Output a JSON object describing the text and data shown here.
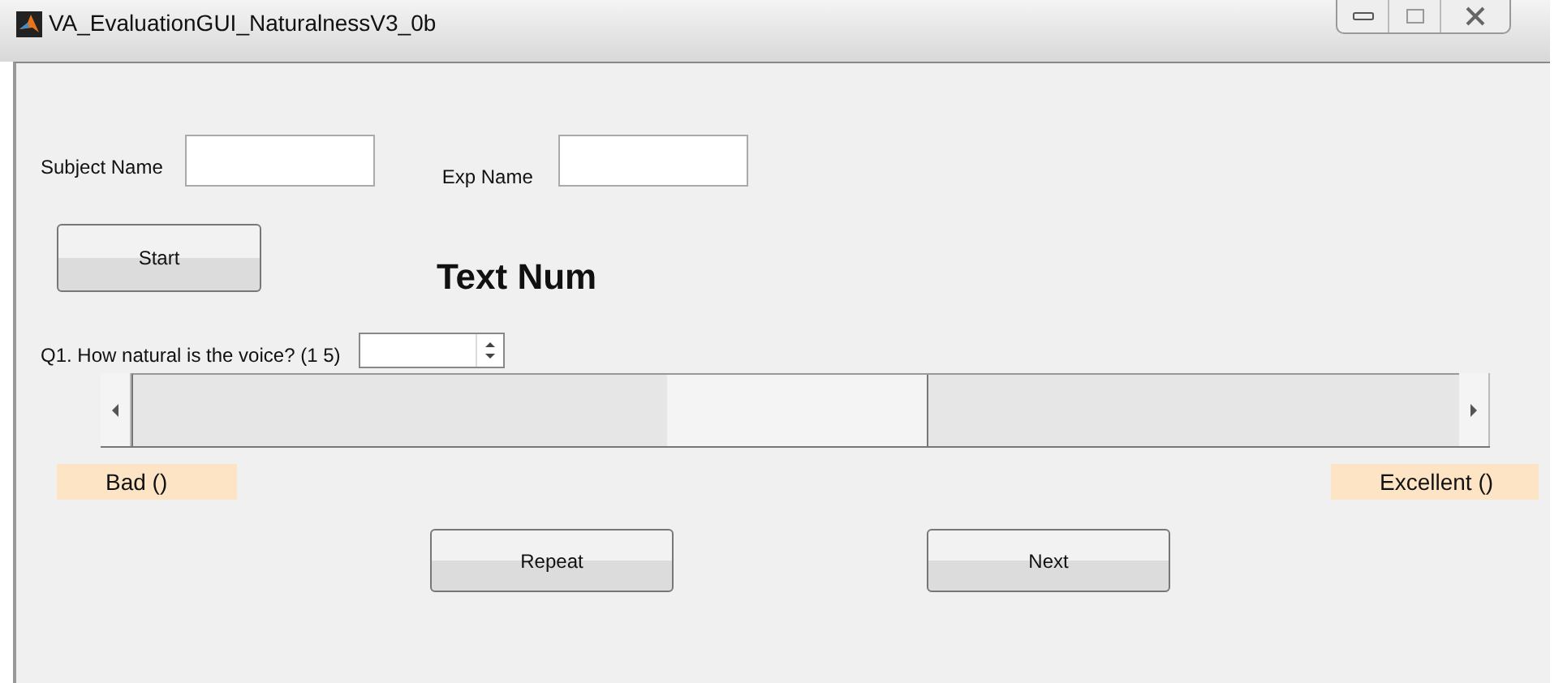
{
  "window": {
    "title": "VA_EvaluationGUI_NaturalnessV3_0b"
  },
  "subject_name": {
    "label": "Subject Name"
  },
  "exp_name": {
    "label": "Exp Name"
  },
  "start_button": "Start",
  "heading": "Text Num",
  "question": {
    "label": "Q1. How natural is the voice? (1  5)"
  },
  "slider": {
    "level": 0.5
  },
  "scale_labels": [
    "Bad ()",
    "Excellent ()"
  ],
  "buttons": [
    "Repeat",
    "Next"
  ]
}
